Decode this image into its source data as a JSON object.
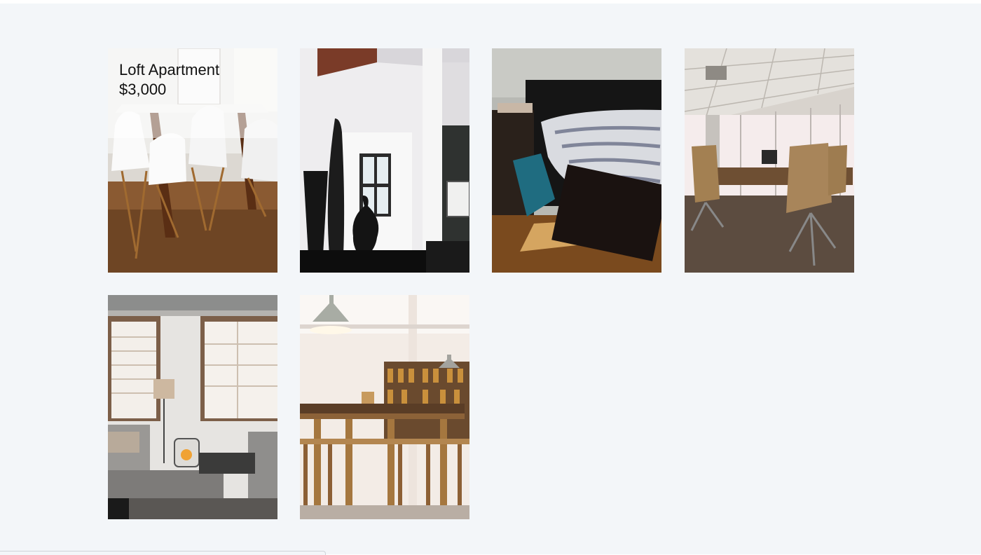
{
  "listings": [
    {
      "title": "Loft Apartment",
      "price": "$3,000",
      "image": "dining-room-white-chairs"
    },
    {
      "title": "",
      "price": "",
      "image": "white-interior-black-vases"
    },
    {
      "title": "",
      "price": "",
      "image": "bedroom-striped-bedding"
    },
    {
      "title": "",
      "price": "",
      "image": "conference-room-office"
    },
    {
      "title": "",
      "price": "",
      "image": "loft-living-room-windows"
    },
    {
      "title": "",
      "price": "",
      "image": "cafe-wooden-high-table"
    }
  ]
}
